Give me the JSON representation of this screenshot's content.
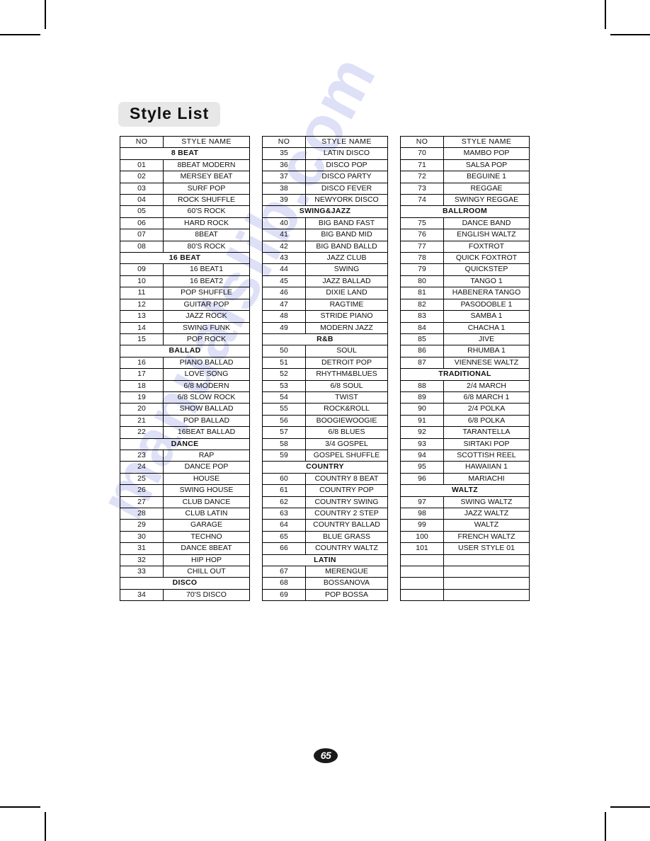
{
  "page": {
    "title": "Style  List",
    "page_number": "65",
    "watermark": "manualslib.com"
  },
  "table": {
    "headers": {
      "no": "NO",
      "name": "STYLE  NAME"
    },
    "columns": [
      {
        "rows": [
          {
            "type": "group",
            "label": "8 BEAT"
          },
          {
            "type": "item",
            "no": "01",
            "name": "8BEAT MODERN"
          },
          {
            "type": "item",
            "no": "02",
            "name": "MERSEY BEAT"
          },
          {
            "type": "item",
            "no": "03",
            "name": "SURF  POP"
          },
          {
            "type": "item",
            "no": "04",
            "name": "ROCK SHUFFLE"
          },
          {
            "type": "item",
            "no": "05",
            "name": "60'S ROCK"
          },
          {
            "type": "item",
            "no": "06",
            "name": "HARD ROCK"
          },
          {
            "type": "item",
            "no": "07",
            "name": "8BEAT"
          },
          {
            "type": "item",
            "no": "08",
            "name": "80'S ROCK"
          },
          {
            "type": "group",
            "label": "16 BEAT"
          },
          {
            "type": "item",
            "no": "09",
            "name": "16 BEAT1"
          },
          {
            "type": "item",
            "no": "10",
            "name": "16 BEAT2"
          },
          {
            "type": "item",
            "no": "11",
            "name": "POP SHUFFLE"
          },
          {
            "type": "item",
            "no": "12",
            "name": "GUITAR POP"
          },
          {
            "type": "item",
            "no": "13",
            "name": "JAZZ ROCK"
          },
          {
            "type": "item",
            "no": "14",
            "name": "SWING FUNK"
          },
          {
            "type": "item",
            "no": "15",
            "name": "POP ROCK"
          },
          {
            "type": "group",
            "label": "BALLAD"
          },
          {
            "type": "item",
            "no": "16",
            "name": "PIANO BALLAD"
          },
          {
            "type": "item",
            "no": "17",
            "name": "LOVE SONG"
          },
          {
            "type": "item",
            "no": "18",
            "name": "6/8 MODERN"
          },
          {
            "type": "item",
            "no": "19",
            "name": "6/8 SLOW ROCK"
          },
          {
            "type": "item",
            "no": "20",
            "name": "SHOW BALLAD"
          },
          {
            "type": "item",
            "no": "21",
            "name": "POP BALLAD"
          },
          {
            "type": "item",
            "no": "22",
            "name": "16BEAT BALLAD"
          },
          {
            "type": "group",
            "label": "DANCE"
          },
          {
            "type": "item",
            "no": "23",
            "name": "RAP"
          },
          {
            "type": "item",
            "no": "24",
            "name": "DANCE POP"
          },
          {
            "type": "item",
            "no": "25",
            "name": "HOUSE"
          },
          {
            "type": "item",
            "no": "26",
            "name": "SWING HOUSE"
          },
          {
            "type": "item",
            "no": "27",
            "name": "CLUB DANCE"
          },
          {
            "type": "item",
            "no": "28",
            "name": "CLUB LATIN"
          },
          {
            "type": "item",
            "no": "29",
            "name": "GARAGE"
          },
          {
            "type": "item",
            "no": "30",
            "name": "TECHNO"
          },
          {
            "type": "item",
            "no": "31",
            "name": "DANCE 8BEAT"
          },
          {
            "type": "item",
            "no": "32",
            "name": "HIP HOP"
          },
          {
            "type": "item",
            "no": "33",
            "name": "CHILL OUT"
          },
          {
            "type": "group",
            "label": "DISCO"
          },
          {
            "type": "item",
            "no": "34",
            "name": "70'S DISCO"
          }
        ]
      },
      {
        "rows": [
          {
            "type": "item",
            "no": "35",
            "name": "LATIN DISCO"
          },
          {
            "type": "item",
            "no": "36",
            "name": "DISCO POP"
          },
          {
            "type": "item",
            "no": "37",
            "name": "DISCO PARTY"
          },
          {
            "type": "item",
            "no": "38",
            "name": "DISCO FEVER"
          },
          {
            "type": "item",
            "no": "39",
            "name": "NEWYORK DISCO"
          },
          {
            "type": "group",
            "label": "SWING&JAZZ"
          },
          {
            "type": "item",
            "no": "40",
            "name": "BIG BAND FAST"
          },
          {
            "type": "item",
            "no": "41",
            "name": "BIG BAND MID"
          },
          {
            "type": "item",
            "no": "42",
            "name": "BIG BAND BALLD"
          },
          {
            "type": "item",
            "no": "43",
            "name": "JAZZ CLUB"
          },
          {
            "type": "item",
            "no": "44",
            "name": "SWING"
          },
          {
            "type": "item",
            "no": "45",
            "name": "JAZZ BALLAD"
          },
          {
            "type": "item",
            "no": "46",
            "name": "DIXIE LAND"
          },
          {
            "type": "item",
            "no": "47",
            "name": "RAGTIME"
          },
          {
            "type": "item",
            "no": "48",
            "name": "STRIDE PIANO"
          },
          {
            "type": "item",
            "no": "49",
            "name": "MODERN JAZZ"
          },
          {
            "type": "group",
            "label": "R&B"
          },
          {
            "type": "item",
            "no": "50",
            "name": "SOUL"
          },
          {
            "type": "item",
            "no": "51",
            "name": "DETROIT POP"
          },
          {
            "type": "item",
            "no": "52",
            "name": "RHYTHM&BLUES"
          },
          {
            "type": "item",
            "no": "53",
            "name": "6/8 SOUL"
          },
          {
            "type": "item",
            "no": "54",
            "name": "TWIST"
          },
          {
            "type": "item",
            "no": "55",
            "name": "ROCK&ROLL"
          },
          {
            "type": "item",
            "no": "56",
            "name": "BOOGIEWOOGIE"
          },
          {
            "type": "item",
            "no": "57",
            "name": "6/8 BLUES"
          },
          {
            "type": "item",
            "no": "58",
            "name": "3/4  GOSPEL"
          },
          {
            "type": "item",
            "no": "59",
            "name": "GOSPEL SHUFFLE"
          },
          {
            "type": "group",
            "label": "COUNTRY"
          },
          {
            "type": "item",
            "no": "60",
            "name": "COUNTRY 8 BEAT"
          },
          {
            "type": "item",
            "no": "61",
            "name": "COUNTRY POP"
          },
          {
            "type": "item",
            "no": "62",
            "name": "COUNTRY SWING"
          },
          {
            "type": "item",
            "no": "63",
            "name": "COUNTRY 2 STEP"
          },
          {
            "type": "item",
            "no": "64",
            "name": "COUNTRY BALLAD"
          },
          {
            "type": "item",
            "no": "65",
            "name": "BLUE GRASS"
          },
          {
            "type": "item",
            "no": "66",
            "name": "COUNTRY WALTZ"
          },
          {
            "type": "group",
            "label": "LATIN"
          },
          {
            "type": "item",
            "no": "67",
            "name": "MERENGUE"
          },
          {
            "type": "item",
            "no": "68",
            "name": "BOSSANOVA"
          },
          {
            "type": "item",
            "no": "69",
            "name": "POP BOSSA"
          }
        ]
      },
      {
        "rows": [
          {
            "type": "item",
            "no": "70",
            "name": "MAMBO POP"
          },
          {
            "type": "item",
            "no": "71",
            "name": "SALSA POP"
          },
          {
            "type": "item",
            "no": "72",
            "name": "BEGUINE 1"
          },
          {
            "type": "item",
            "no": "73",
            "name": "REGGAE"
          },
          {
            "type": "item",
            "no": "74",
            "name": "SWINGY REGGAE"
          },
          {
            "type": "group",
            "label": "BALLROOM"
          },
          {
            "type": "item",
            "no": "75",
            "name": "DANCE BAND"
          },
          {
            "type": "item",
            "no": "76",
            "name": "ENGLISH WALTZ"
          },
          {
            "type": "item",
            "no": "77",
            "name": "FOXTROT"
          },
          {
            "type": "item",
            "no": "78",
            "name": "QUICK FOXTROT"
          },
          {
            "type": "item",
            "no": "79",
            "name": "QUICKSTEP"
          },
          {
            "type": "item",
            "no": "80",
            "name": "TANGO 1"
          },
          {
            "type": "item",
            "no": "81",
            "name": "HABENERA TANGO"
          },
          {
            "type": "item",
            "no": "82",
            "name": "PASODOBLE 1"
          },
          {
            "type": "item",
            "no": "83",
            "name": "SAMBA 1"
          },
          {
            "type": "item",
            "no": "84",
            "name": "CHACHA 1"
          },
          {
            "type": "item",
            "no": "85",
            "name": "JIVE"
          },
          {
            "type": "item",
            "no": "86",
            "name": "RHUMBA 1"
          },
          {
            "type": "item",
            "no": "87",
            "name": "VIENNESE WALTZ"
          },
          {
            "type": "group",
            "label": "TRADITIONAL"
          },
          {
            "type": "item",
            "no": "88",
            "name": "2/4 MARCH"
          },
          {
            "type": "item",
            "no": "89",
            "name": "6/8 MARCH 1"
          },
          {
            "type": "item",
            "no": "90",
            "name": "2/4 POLKA"
          },
          {
            "type": "item",
            "no": "91",
            "name": "6/8 POLKA"
          },
          {
            "type": "item",
            "no": "92",
            "name": "TARANTELLA"
          },
          {
            "type": "item",
            "no": "93",
            "name": "SIRTAKI POP"
          },
          {
            "type": "item",
            "no": "94",
            "name": "SCOTTISH REEL"
          },
          {
            "type": "item",
            "no": "95",
            "name": "HAWAIIAN 1"
          },
          {
            "type": "item",
            "no": "96",
            "name": "MARIACHI"
          },
          {
            "type": "group",
            "label": "WALTZ"
          },
          {
            "type": "item",
            "no": "97",
            "name": "SWING WALTZ"
          },
          {
            "type": "item",
            "no": "98",
            "name": "JAZZ WALTZ"
          },
          {
            "type": "item",
            "no": "99",
            "name": "WALTZ"
          },
          {
            "type": "item",
            "no": "100",
            "name": "FRENCH WALTZ"
          },
          {
            "type": "item",
            "no": "101",
            "name": "USER STYLE 01"
          },
          {
            "type": "empty",
            "no": "",
            "name": ""
          },
          {
            "type": "empty",
            "no": "",
            "name": ""
          },
          {
            "type": "empty",
            "no": "",
            "name": ""
          },
          {
            "type": "empty",
            "no": "",
            "name": ""
          }
        ]
      }
    ]
  }
}
